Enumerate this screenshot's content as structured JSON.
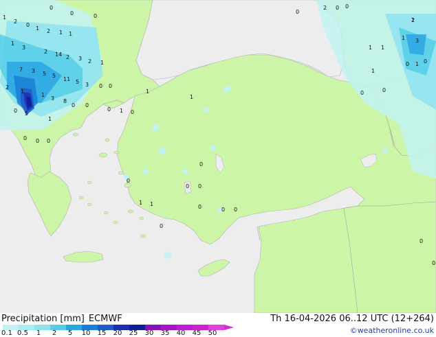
{
  "map": {
    "land_color": "#ccf5a8",
    "sea_color": "#ededed",
    "precip_colors": [
      "#c2f2f2",
      "#8fe3f0",
      "#55cce8",
      "#2aa6e0",
      "#1a7fd4",
      "#1f5cc8",
      "#1a30b4",
      "#101e94"
    ],
    "values": [
      {
        "t": "1"
      },
      {
        "t": "0"
      },
      {
        "t": "0"
      },
      {
        "t": "0"
      },
      {
        "t": "2"
      },
      {
        "t": "0"
      },
      {
        "t": "1"
      },
      {
        "t": "2"
      },
      {
        "t": "1"
      },
      {
        "t": "1"
      },
      {
        "t": "1"
      },
      {
        "t": "3"
      },
      {
        "t": "2"
      },
      {
        "t": "14"
      },
      {
        "t": "2"
      },
      {
        "t": "3"
      },
      {
        "t": "2"
      },
      {
        "t": "1"
      },
      {
        "t": "7"
      },
      {
        "t": "3"
      },
      {
        "t": "5"
      },
      {
        "t": "5"
      },
      {
        "t": "11"
      },
      {
        "t": "5"
      },
      {
        "t": "3"
      },
      {
        "t": "2"
      },
      {
        "t": "1"
      },
      {
        "t": "1"
      },
      {
        "t": "3"
      },
      {
        "t": "8"
      },
      {
        "t": "0"
      },
      {
        "t": "0"
      },
      {
        "t": "5"
      },
      {
        "t": "0"
      },
      {
        "t": "1"
      },
      {
        "t": "0"
      },
      {
        "t": "0"
      },
      {
        "t": "0"
      },
      {
        "t": "1"
      },
      {
        "t": "0"
      },
      {
        "t": "0"
      },
      {
        "t": "0"
      },
      {
        "t": "2"
      },
      {
        "t": "0"
      },
      {
        "t": "0"
      },
      {
        "t": "1"
      },
      {
        "t": "3"
      },
      {
        "t": "2"
      },
      {
        "t": "1"
      },
      {
        "t": "1"
      },
      {
        "t": "1"
      },
      {
        "t": "0"
      },
      {
        "t": "1"
      },
      {
        "t": "0"
      },
      {
        "t": "0"
      },
      {
        "t": "1"
      },
      {
        "t": "1"
      },
      {
        "t": "0"
      },
      {
        "t": "0"
      },
      {
        "t": "0"
      },
      {
        "t": "0"
      },
      {
        "t": "0"
      },
      {
        "t": "0"
      },
      {
        "t": "0"
      },
      {
        "t": "0"
      },
      {
        "t": "1"
      },
      {
        "t": "1"
      },
      {
        "t": "0"
      },
      {
        "t": "0"
      },
      {
        "t": "1"
      },
      {
        "t": "0"
      },
      {
        "t": "0"
      },
      {
        "t": "0"
      }
    ]
  },
  "footer": {
    "title_main": "Precipitation [mm]",
    "title_model": "ECMWF",
    "date": "Th 16-04-2026 06..12 UTC (12+264)",
    "credit": "©weatheronline.co.uk"
  },
  "legend": {
    "colors": [
      "#c2f2f2",
      "#a8ecf4",
      "#8fe3f0",
      "#55cce8",
      "#2aa6e0",
      "#1a7fd4",
      "#1f5cc8",
      "#1a30b4",
      "#101e94",
      "#8a10b8",
      "#a414c8",
      "#bb1cd4",
      "#cc22cc",
      "#e040dc"
    ],
    "arrow_color": "#cc33cc",
    "ticks": [
      "0.1",
      "0.5",
      "1",
      "2",
      "5",
      "10",
      "15",
      "20",
      "25",
      "30",
      "35",
      "40",
      "45",
      "50"
    ]
  }
}
